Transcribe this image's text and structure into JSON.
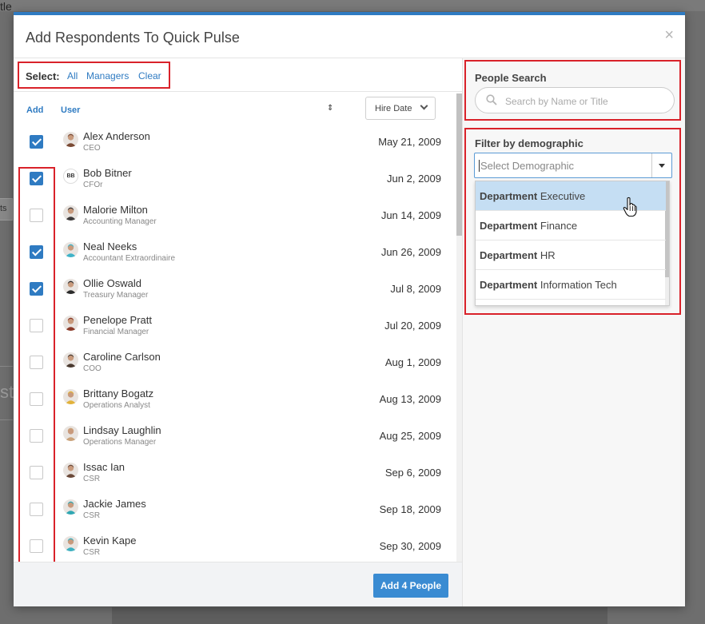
{
  "background": {
    "top_left_text": "tle",
    "left_button_text": "ts",
    "left_text": "st"
  },
  "modal": {
    "title": "Add Respondents To Quick Pulse",
    "close": "×",
    "select": {
      "label": "Select:",
      "all": "All",
      "managers": "Managers",
      "clear": "Clear"
    },
    "columns": {
      "add": "Add",
      "user": "User",
      "sort_icon": "⇕",
      "hire_date": "Hire Date"
    },
    "people": [
      {
        "name": "Alex Anderson",
        "title": "CEO",
        "date": "May 21, 2009",
        "checked": true,
        "avatar": "photo",
        "color": "#7a4a34"
      },
      {
        "name": "Bob Bitner",
        "title": "CFOr",
        "date": "Jun 2, 2009",
        "checked": true,
        "avatar": "initials",
        "initials": "BB"
      },
      {
        "name": "Malorie Milton",
        "title": "Accounting Manager",
        "date": "Jun 14, 2009",
        "checked": false,
        "avatar": "photo",
        "color": "#3d3a3a"
      },
      {
        "name": "Neal Neeks",
        "title": "Accountant Extraordinaire",
        "date": "Jun 26, 2009",
        "checked": true,
        "avatar": "photo",
        "color": "#3fb3c8"
      },
      {
        "name": "Ollie Oswald",
        "title": "Treasury Manager",
        "date": "Jul 8, 2009",
        "checked": true,
        "avatar": "photo",
        "color": "#2b2b2b"
      },
      {
        "name": "Penelope Pratt",
        "title": "Financial Manager",
        "date": "Jul 20, 2009",
        "checked": false,
        "avatar": "photo",
        "color": "#8a3b2a"
      },
      {
        "name": "Caroline Carlson",
        "title": "COO",
        "date": "Aug 1, 2009",
        "checked": false,
        "avatar": "photo",
        "color": "#4a3a30"
      },
      {
        "name": "Brittany Bogatz",
        "title": "Operations Analyst",
        "date": "Aug 13, 2009",
        "checked": false,
        "avatar": "photo",
        "color": "#e2b23a"
      },
      {
        "name": "Lindsay Laughlin",
        "title": "Operations Manager",
        "date": "Aug 25, 2009",
        "checked": false,
        "avatar": "photo",
        "color": "#caa27a"
      },
      {
        "name": "Issac Ian",
        "title": "CSR",
        "date": "Sep 6, 2009",
        "checked": false,
        "avatar": "photo",
        "color": "#6b4a3a"
      },
      {
        "name": "Jackie James",
        "title": "CSR",
        "date": "Sep 18, 2009",
        "checked": false,
        "avatar": "photo",
        "color": "#2fa7b3"
      },
      {
        "name": "Kevin Kape",
        "title": "CSR",
        "date": "Sep 30, 2009",
        "checked": false,
        "avatar": "photo",
        "color": "#3db0c0"
      }
    ],
    "add_people_button": "Add 4 People",
    "people_search": {
      "label": "People Search",
      "placeholder": "Search by Name or Title"
    },
    "filter": {
      "label": "Filter by demographic",
      "placeholder": "Select Demographic",
      "options": [
        {
          "key": "Department",
          "value": "Executive",
          "highlighted": true
        },
        {
          "key": "Department",
          "value": "Finance",
          "highlighted": false
        },
        {
          "key": "Department",
          "value": "HR",
          "highlighted": false
        },
        {
          "key": "Department",
          "value": "Information Tech",
          "highlighted": false
        }
      ]
    }
  },
  "colors": {
    "accent": "#2f7bc2",
    "highlight": "#d9222a",
    "button": "#3a8bd2",
    "option_highlight": "#c5def3"
  }
}
